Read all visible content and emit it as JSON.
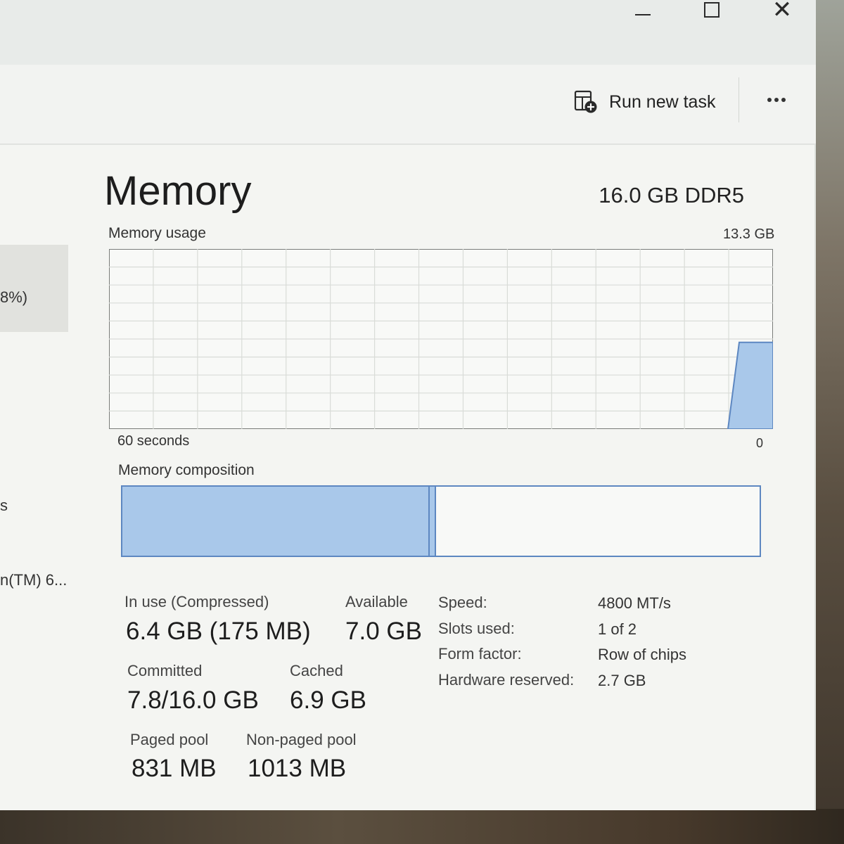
{
  "toolbar": {
    "run_new_task": "Run new task"
  },
  "sidebar": {
    "percent_fragment": "8%)",
    "fragment_2": "s",
    "fragment_3": "n(TM) 6..."
  },
  "memory": {
    "title": "Memory",
    "spec": "16.0 GB DDR5",
    "usage_label": "Memory usage",
    "usage_max": "13.3 GB",
    "axis_left": "60 seconds",
    "axis_right": "0",
    "composition_label": "Memory composition",
    "composition": {
      "in_use_fraction": 0.48,
      "modified_fraction": 0.012
    },
    "usage_history": [
      0,
      0,
      0,
      0,
      0,
      0,
      0,
      0,
      0,
      0,
      0,
      0,
      0,
      0,
      0,
      0,
      0,
      0,
      0,
      0,
      0,
      0,
      0,
      0,
      0,
      0,
      0,
      0,
      0,
      0,
      0,
      0,
      0,
      0,
      0,
      0,
      0,
      0,
      0,
      0,
      0,
      0,
      0,
      0,
      0,
      0,
      0,
      0,
      0,
      0,
      0,
      0,
      0,
      0,
      0,
      0,
      6.4,
      6.4,
      6.4,
      6.4
    ]
  },
  "stats": {
    "in_use_label": "In use (Compressed)",
    "in_use_value": "6.4 GB (175 MB)",
    "available_label": "Available",
    "available_value": "7.0 GB",
    "committed_label": "Committed",
    "committed_value": "7.8/16.0 GB",
    "cached_label": "Cached",
    "cached_value": "6.9 GB",
    "paged_label": "Paged pool",
    "paged_value": "831 MB",
    "nonpaged_label": "Non-paged pool",
    "nonpaged_value": "1013 MB"
  },
  "details": [
    {
      "key": "Speed:",
      "value": "4800 MT/s"
    },
    {
      "key": "Slots used:",
      "value": "1 of 2"
    },
    {
      "key": "Form factor:",
      "value": "Row of chips"
    },
    {
      "key": "Hardware reserved:",
      "value": "2.7 GB"
    }
  ],
  "colors": {
    "graph_fill": "#a9c8ea",
    "graph_line": "#5d87c1",
    "grid": "#d9dcd8"
  }
}
